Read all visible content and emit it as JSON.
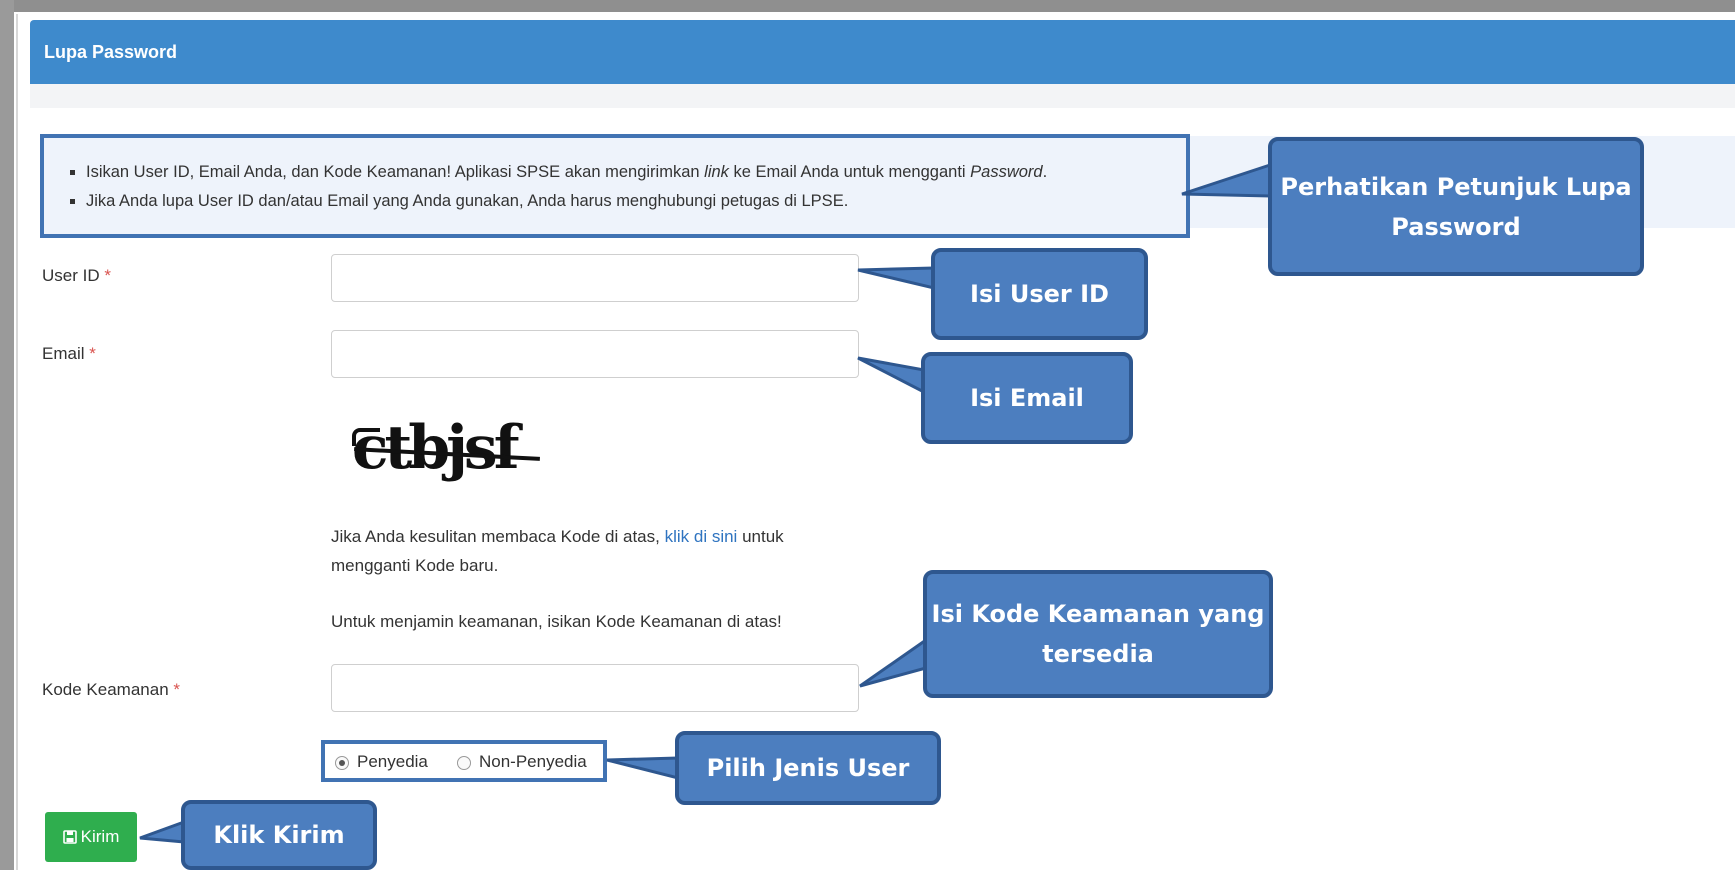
{
  "header": {
    "title": "Lupa Password"
  },
  "info": {
    "items": [
      {
        "before": "Isikan User ID, Email Anda, dan Kode Keamanan! Aplikasi SPSE akan mengirimkan ",
        "link_word": "link",
        "middle": " ke Email Anda untuk mengganti ",
        "pw_word": "Password",
        "after": "."
      },
      {
        "text": "Jika Anda lupa User ID dan/atau Email yang Anda gunakan, Anda harus menghubungi petugas di LPSE."
      }
    ]
  },
  "form": {
    "user_id_label": "User ID",
    "email_label": "Email",
    "kode_label": "Kode Keamanan",
    "required_mark": "*",
    "user_id_value": "",
    "email_value": "",
    "kode_value": "",
    "captcha_text": "ctbjsf",
    "help_before": "Jika Anda kesulitan membaca Kode di atas, ",
    "help_link": "klik di sini",
    "help_after": " untuk mengganti Kode baru.",
    "help2": "Untuk menjamin keamanan, isikan Kode Keamanan di atas!",
    "radio_options": [
      "Penyedia",
      "Non-Penyedia"
    ],
    "radio_selected": "Penyedia",
    "submit_label": "Kirim",
    "submit_icon": "save-icon"
  },
  "callouts": {
    "petunjuk": "Perhatikan Petunjuk Lupa Password",
    "user_id": "Isi User ID",
    "email": "Isi Email",
    "kode": "Isi Kode Keamanan yang tersedia",
    "jenis_user": "Pilih Jenis User",
    "kirim": "Klik Kirim"
  },
  "colors": {
    "header_bg": "#3e8acc",
    "callout_bg": "#4c7ebf",
    "callout_border": "#2e578f",
    "submit_bg": "#2fae4e",
    "link": "#2f74c0",
    "required": "#d9534f"
  }
}
